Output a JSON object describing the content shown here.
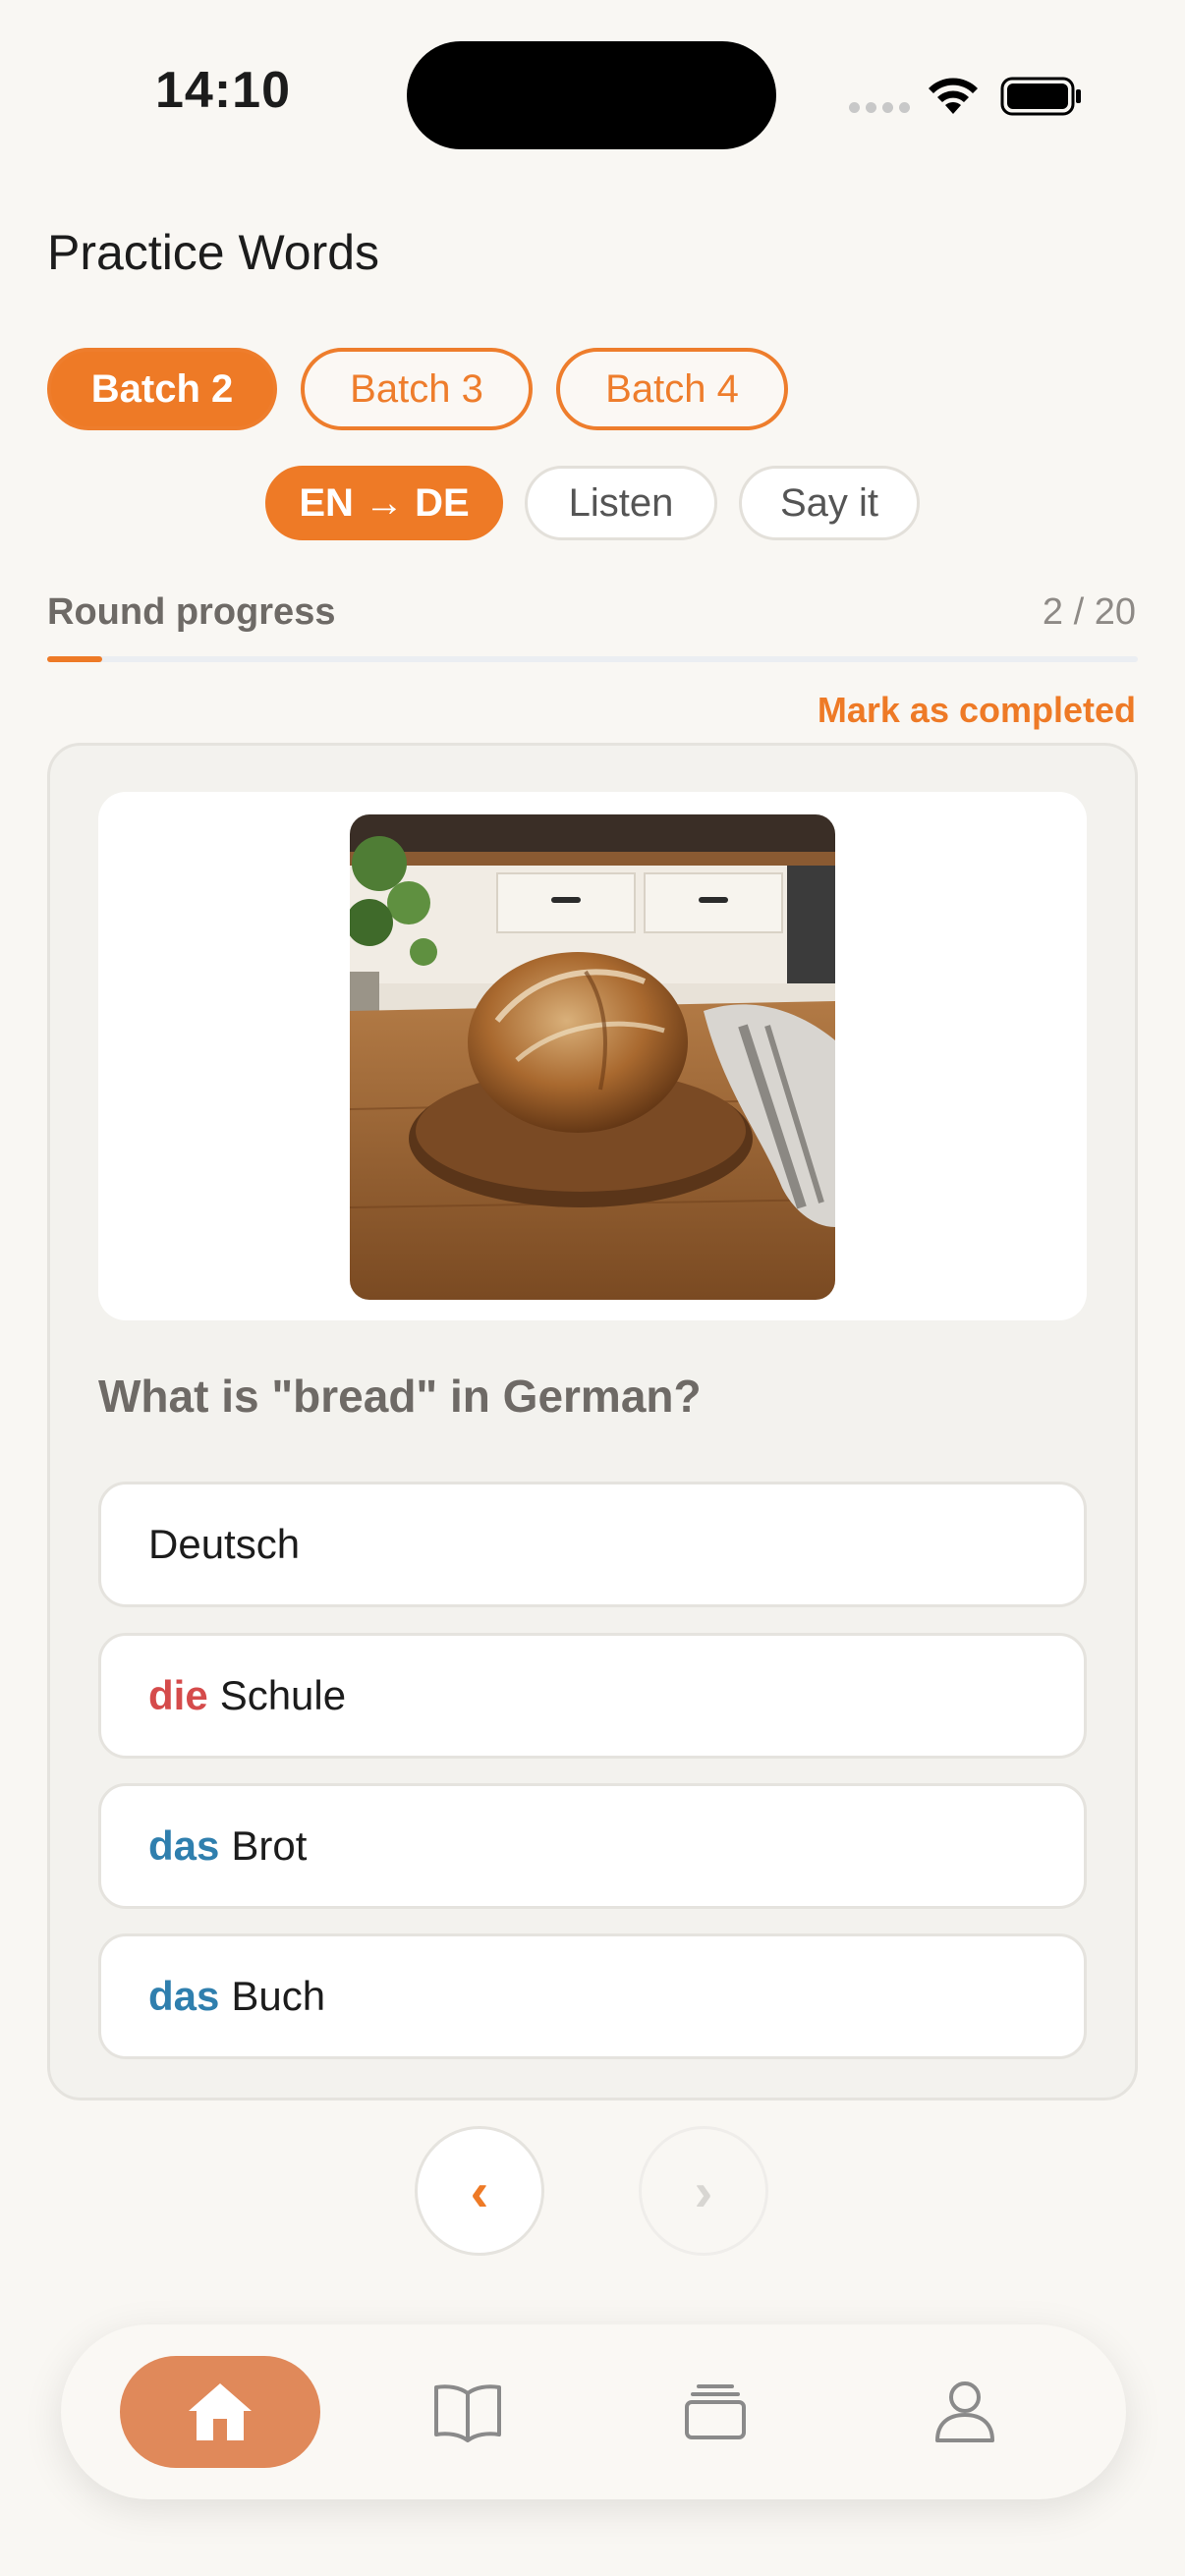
{
  "status_bar": {
    "time": "14:10"
  },
  "header": {
    "title": "Practice Words"
  },
  "batches": [
    {
      "label": "Batch 2",
      "active": true
    },
    {
      "label": "Batch 3",
      "active": false
    },
    {
      "label": "Batch 4",
      "active": false
    }
  ],
  "modes": [
    {
      "label": "EN → DE",
      "active": true
    },
    {
      "label": "Listen",
      "active": false
    },
    {
      "label": "Say it",
      "active": false
    }
  ],
  "progress": {
    "label": "Round progress",
    "current": 2,
    "total": 20,
    "count_text": "2 / 20",
    "fraction": 0.1
  },
  "mark_completed": "Mark as completed",
  "question": "What is \"bread\" in German?",
  "options": [
    {
      "article": "",
      "word": "Deutsch"
    },
    {
      "article": "die",
      "word": "Schule"
    },
    {
      "article": "das",
      "word": "Brot"
    },
    {
      "article": "das",
      "word": "Buch"
    }
  ],
  "nav": {
    "prev_icon": "‹",
    "next_icon": "›"
  },
  "tabbar": {
    "items": [
      {
        "icon": "home-icon",
        "active": true
      },
      {
        "icon": "book-icon",
        "active": false
      },
      {
        "icon": "cards-icon",
        "active": false
      },
      {
        "icon": "profile-icon",
        "active": false
      }
    ]
  },
  "colors": {
    "accent": "#ee7a26",
    "tab_active": "#e0895a",
    "die": "#d54b4b",
    "das": "#2f7fae",
    "background": "#f9f7f3"
  }
}
